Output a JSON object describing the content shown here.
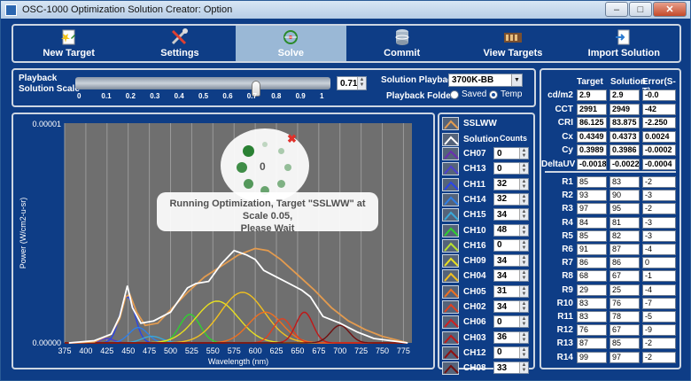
{
  "window": {
    "title": "OSC-1000 Optimization Solution Creator: Option",
    "min": "–",
    "max": "□",
    "close": "✕"
  },
  "toolbar": [
    {
      "label": "New Target",
      "icon": "new-target-icon"
    },
    {
      "label": "Settings",
      "icon": "tools-icon"
    },
    {
      "label": "Solve",
      "icon": "solve-icon",
      "active": true
    },
    {
      "label": "Commit",
      "icon": "database-icon"
    },
    {
      "label": "View Targets",
      "icon": "targets-icon"
    },
    {
      "label": "Import Solution",
      "icon": "import-icon"
    }
  ],
  "scale": {
    "label1": "Playback",
    "label2": "Solution Scale",
    "ticks": [
      "0",
      "0.1",
      "0.2",
      "0.3",
      "0.4",
      "0.5",
      "0.6",
      "0.7",
      "0.8",
      "0.9",
      "1"
    ],
    "value": "0.71",
    "slider_fraction": 0.71
  },
  "playback": {
    "solution_label": "Solution Playback",
    "solution_value": "3700K-BB",
    "folder_label": "Playback Folder",
    "saved": "Saved",
    "temp": "Temp"
  },
  "overlay": {
    "counter": "0",
    "message_line1": "Running Optimization, Target \"SSLWW\" at Scale 0.05,",
    "message_line2": "Please Wait"
  },
  "channels_header": "Counts",
  "channels": [
    {
      "name": "SSLWW",
      "color": "#e39b4f",
      "count": null
    },
    {
      "name": "Solution",
      "color": "#ffffff",
      "count": null
    },
    {
      "name": "CH07",
      "color": "#6a2fb0",
      "count": "0"
    },
    {
      "name": "CH13",
      "color": "#4b3fd0",
      "count": "0"
    },
    {
      "name": "CH11",
      "color": "#2a45e8",
      "count": "32"
    },
    {
      "name": "CH14",
      "color": "#2f7fe8",
      "count": "32"
    },
    {
      "name": "CH15",
      "color": "#3aa8d8",
      "count": "34"
    },
    {
      "name": "CH10",
      "color": "#2fd030",
      "count": "48"
    },
    {
      "name": "CH16",
      "color": "#b8e030",
      "count": "0"
    },
    {
      "name": "CH09",
      "color": "#e8e020",
      "count": "34"
    },
    {
      "name": "CH04",
      "color": "#f0c020",
      "count": "34"
    },
    {
      "name": "CH05",
      "color": "#f07020",
      "count": "31"
    },
    {
      "name": "CH02",
      "color": "#e04020",
      "count": "34"
    },
    {
      "name": "CH06",
      "color": "#d02020",
      "count": "0"
    },
    {
      "name": "CH03",
      "color": "#c01818",
      "count": "36"
    },
    {
      "name": "CH12",
      "color": "#901010",
      "count": "0"
    },
    {
      "name": "CH08",
      "color": "#701010",
      "count": "33"
    }
  ],
  "table": {
    "headers": [
      "Target",
      "Solution",
      "Error(S-T)"
    ],
    "metrics": [
      {
        "label": "cd/m2",
        "target": "2.9",
        "solution": "2.9",
        "error": "-0.0"
      },
      {
        "label": "CCT",
        "target": "2991",
        "solution": "2949",
        "error": "-42"
      },
      {
        "label": "CRI",
        "target": "86.125",
        "solution": "83.875",
        "error": "-2.250"
      },
      {
        "label": "Cx",
        "target": "0.4349",
        "solution": "0.4373",
        "error": "0.0024"
      },
      {
        "label": "Cy",
        "target": "0.3989",
        "solution": "0.3986",
        "error": "-0.0002"
      },
      {
        "label": "DeltaUV",
        "target": "-0.0018",
        "solution": "-0.0022",
        "error": "-0.0004"
      }
    ],
    "r_values": [
      {
        "label": "R1",
        "target": "85",
        "solution": "83",
        "error": "-2"
      },
      {
        "label": "R2",
        "target": "93",
        "solution": "90",
        "error": "-3"
      },
      {
        "label": "R3",
        "target": "97",
        "solution": "95",
        "error": "-2"
      },
      {
        "label": "R4",
        "target": "84",
        "solution": "81",
        "error": "-3"
      },
      {
        "label": "R5",
        "target": "85",
        "solution": "82",
        "error": "-3"
      },
      {
        "label": "R6",
        "target": "91",
        "solution": "87",
        "error": "-4"
      },
      {
        "label": "R7",
        "target": "86",
        "solution": "86",
        "error": "0"
      },
      {
        "label": "R8",
        "target": "68",
        "solution": "67",
        "error": "-1"
      },
      {
        "label": "R9",
        "target": "29",
        "solution": "25",
        "error": "-4"
      },
      {
        "label": "R10",
        "target": "83",
        "solution": "76",
        "error": "-7"
      },
      {
        "label": "R11",
        "target": "83",
        "solution": "78",
        "error": "-5"
      },
      {
        "label": "R12",
        "target": "76",
        "solution": "67",
        "error": "-9"
      },
      {
        "label": "R13",
        "target": "87",
        "solution": "85",
        "error": "-2"
      },
      {
        "label": "R14",
        "target": "99",
        "solution": "97",
        "error": "-2"
      }
    ]
  },
  "chart_data": {
    "type": "line",
    "ylabel": "Power (W/cm2-u-sr)",
    "xlabel": "Wavelength (nm)",
    "xlim": [
      375,
      785
    ],
    "ylim": [
      0,
      1e-05
    ],
    "y_ticks": [
      "0.00000",
      "0.00001"
    ],
    "x_ticks": [
      375,
      400,
      425,
      450,
      475,
      500,
      525,
      550,
      575,
      600,
      625,
      650,
      675,
      700,
      725,
      750,
      775
    ],
    "peaks": [
      {
        "name": "CH07",
        "center": 405,
        "width": 8,
        "amp": 6e-08
      },
      {
        "name": "CH13",
        "center": 425,
        "width": 8,
        "amp": 2e-07
      },
      {
        "name": "CH11",
        "center": 449,
        "width": 9,
        "amp": 2.1e-06
      },
      {
        "name": "CH14",
        "center": 462,
        "width": 11,
        "amp": 7e-07
      },
      {
        "name": "CH15",
        "center": 478,
        "width": 12,
        "amp": 3e-07
      },
      {
        "name": "CH10",
        "center": 523,
        "width": 12,
        "amp": 1.3e-06
      },
      {
        "name": "CH09",
        "center": 555,
        "width": 25,
        "amp": 1.9e-06
      },
      {
        "name": "CH04",
        "center": 585,
        "width": 26,
        "amp": 2.3e-06
      },
      {
        "name": "CH05",
        "center": 612,
        "width": 20,
        "amp": 1.4e-06
      },
      {
        "name": "CH02",
        "center": 632,
        "width": 11,
        "amp": 1.1e-06
      },
      {
        "name": "CH03",
        "center": 658,
        "width": 10,
        "amp": 1.4e-06
      },
      {
        "name": "CH08",
        "center": 700,
        "width": 11,
        "amp": 8e-07
      }
    ],
    "target": {
      "name": "SSLWW",
      "x": [
        380,
        410,
        430,
        440,
        447,
        452,
        460,
        470,
        485,
        500,
        520,
        540,
        560,
        580,
        600,
        615,
        630,
        650,
        670,
        690,
        710,
        730,
        750,
        770,
        780
      ],
      "y": [
        0,
        5e-08,
        4e-07,
        1.1e-06,
        2.1e-06,
        2.2e-06,
        1.4e-06,
        8e-07,
        9e-07,
        1.5e-06,
        2.3e-06,
        3e-06,
        3.5e-06,
        4e-06,
        4.3e-06,
        4.2e-06,
        3.8e-06,
        3.1e-06,
        2.4e-06,
        1.6e-06,
        1e-06,
        6e-07,
        3e-07,
        1e-07,
        0
      ]
    },
    "solution": {
      "name": "Solution",
      "x": [
        380,
        410,
        430,
        440,
        449,
        455,
        465,
        480,
        500,
        520,
        530,
        545,
        560,
        575,
        590,
        600,
        610,
        625,
        640,
        655,
        665,
        680,
        700,
        720,
        740,
        760,
        780
      ],
      "y": [
        0,
        1e-07,
        4e-07,
        1.2e-06,
        2.6e-06,
        1.6e-06,
        9e-07,
        1e-06,
        1.4e-06,
        2.5e-06,
        2.7e-06,
        2.8e-06,
        3.6e-06,
        4.2e-06,
        4e-06,
        3.8e-06,
        3.3e-06,
        3e-06,
        2.7e-06,
        2.4e-06,
        2.1e-06,
        1.2e-06,
        9e-07,
        5e-07,
        2e-07,
        1e-07,
        0
      ]
    }
  }
}
